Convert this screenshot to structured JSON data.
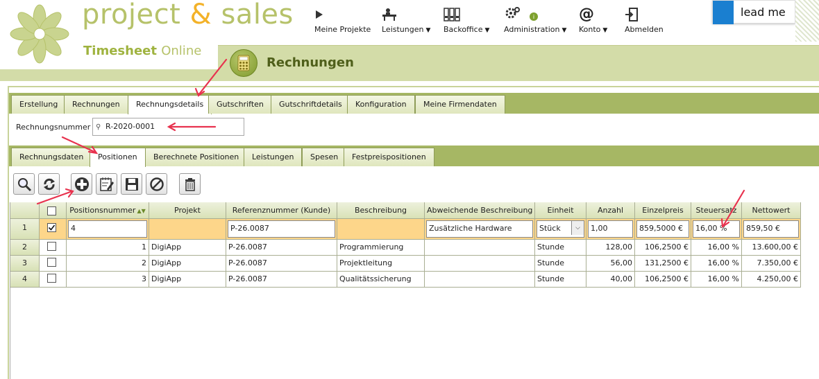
{
  "brand": {
    "title_part1": "project ",
    "title_amp": "&",
    "title_part2": " sales",
    "sub_part1": "Timesheet ",
    "sub_part2": "Online",
    "accent_green": "#b6c26a",
    "accent_orange": "#f3b229"
  },
  "nav": [
    {
      "label": "Meine Projekte",
      "icon": "play-icon",
      "caret": ""
    },
    {
      "label": "Leistungen",
      "icon": "desk-person-icon",
      "caret": "▼"
    },
    {
      "label": "Backoffice",
      "icon": "binders-icon",
      "caret": "▼"
    },
    {
      "label": "Administration",
      "icon": "gears-icon",
      "caret": "▼"
    },
    {
      "label": "Konto",
      "icon": "at-icon",
      "caret": "▼"
    },
    {
      "label": "Abmelden",
      "icon": "logout-door-icon",
      "caret": ""
    }
  ],
  "lead_me": {
    "label": "lead me",
    "color": "#1a7fd0"
  },
  "page": {
    "title": "Rechnungen",
    "icon": "calculator-icon"
  },
  "tabs_main": [
    {
      "label": "Erstellung",
      "active": false
    },
    {
      "label": "Rechnungen",
      "active": false
    },
    {
      "label": "Rechnungsdetails",
      "active": true
    },
    {
      "label": "Gutschriften",
      "active": false
    },
    {
      "label": "Gutschriftdetails",
      "active": false
    },
    {
      "label": "Konfiguration",
      "active": false
    },
    {
      "label": "Meine Firmendaten",
      "active": false
    }
  ],
  "invoice": {
    "label": "Rechnungsnummer",
    "value": "R-2020-0001"
  },
  "tabs_sub": [
    {
      "label": "Rechnungsdaten",
      "active": false
    },
    {
      "label": "Positionen",
      "active": true
    },
    {
      "label": "Berechnete Positionen",
      "active": false
    },
    {
      "label": "Leistungen",
      "active": false
    },
    {
      "label": "Spesen",
      "active": false
    },
    {
      "label": "Festpreispositionen",
      "active": false
    }
  ],
  "toolbar": [
    {
      "name": "search-button",
      "icon": "magnifier-icon"
    },
    {
      "name": "refresh-button",
      "icon": "refresh-icon"
    },
    {
      "name": "add-button",
      "icon": "plus-circle-icon"
    },
    {
      "name": "edit-button",
      "icon": "edit-notepad-icon"
    },
    {
      "name": "save-button",
      "icon": "floppy-disk-icon"
    },
    {
      "name": "cancel-button",
      "icon": "no-entry-icon"
    },
    {
      "name": "delete-button",
      "icon": "trash-icon"
    }
  ],
  "grid": {
    "columns": [
      "",
      "",
      "Positionsnummer",
      "Projekt",
      "Referenznummer (Kunde)",
      "Beschreibung",
      "Abweichende Beschreibung",
      "Einheit",
      "Anzahl",
      "Einzelpreis",
      "Steuersatz",
      "Nettowert"
    ],
    "edit_row": {
      "row": "1",
      "checked": true,
      "pos": "4",
      "projekt": "",
      "ref": "P-26.0087",
      "beschreibung": "",
      "abweichend": "Zusätzliche Hardware",
      "einheit": "Stück",
      "anzahl": "1,00",
      "einzelpreis": "859,5000 €",
      "steuersatz": "16,00 %",
      "netto": "859,50 €"
    },
    "rows": [
      {
        "row": "2",
        "pos": "1",
        "projekt": "DigiApp",
        "ref": "P-26.0087",
        "beschreibung": "Programmierung",
        "abweichend": "",
        "einheit": "Stunde",
        "anzahl": "128,00",
        "einzelpreis": "106,2500 €",
        "steuersatz": "16,00 %",
        "netto": "13.600,00 €"
      },
      {
        "row": "3",
        "pos": "2",
        "projekt": "DigiApp",
        "ref": "P-26.0087",
        "beschreibung": "Projektleitung",
        "abweichend": "",
        "einheit": "Stunde",
        "anzahl": "56,00",
        "einzelpreis": "131,2500 €",
        "steuersatz": "16,00 %",
        "netto": "7.350,00 €"
      },
      {
        "row": "4",
        "pos": "3",
        "projekt": "DigiApp",
        "ref": "P-26.0087",
        "beschreibung": "Qualitätssicherung",
        "abweichend": "",
        "einheit": "Stunde",
        "anzahl": "40,00",
        "einzelpreis": "106,2500 €",
        "steuersatz": "16,00 %",
        "netto": "4.250,00 €"
      }
    ]
  },
  "annotation_color": "#e8324e"
}
